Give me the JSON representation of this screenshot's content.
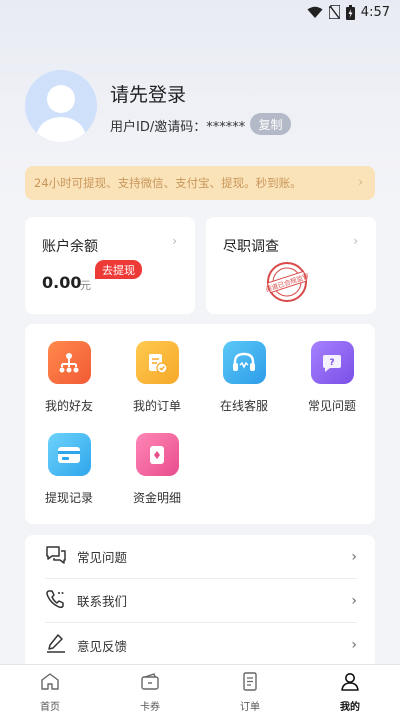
{
  "status_bar": {
    "time": "4:57"
  },
  "profile": {
    "login_prompt": "请先登录",
    "user_id_label": "用户ID/邀请码：",
    "user_id_value": "******",
    "copy_label": "复制"
  },
  "notice": {
    "text": "24小时可提现、支持微信、支付宝、提现。秒到账。"
  },
  "balance_card": {
    "title": "账户余额",
    "withdraw_label": "去提现",
    "amount": "0.00",
    "unit": "元"
  },
  "duty_card": {
    "title": "尽职调查",
    "stamp_text": "渠道已合规监管"
  },
  "grid": {
    "items": [
      {
        "label": "我的好友",
        "icon": "friends-icon",
        "color": "#f66a3c"
      },
      {
        "label": "我的订单",
        "icon": "orders-icon",
        "color": "#f7b73a"
      },
      {
        "label": "在线客服",
        "icon": "headset-icon",
        "color": "#3aaef0"
      },
      {
        "label": "常见问题",
        "icon": "question-icon",
        "color": "#8a62f2"
      },
      {
        "label": "提现记录",
        "icon": "card-icon",
        "color": "#33b4ef"
      },
      {
        "label": "资金明细",
        "icon": "funds-icon",
        "color": "#ee5e9c"
      }
    ]
  },
  "list": {
    "items": [
      {
        "label": "常见问题",
        "icon": "chat-icon"
      },
      {
        "label": "联系我们",
        "icon": "phone-icon"
      },
      {
        "label": "意见反馈",
        "icon": "edit-icon"
      }
    ]
  },
  "tabs": [
    {
      "label": "首页",
      "icon": "home-icon",
      "active": false
    },
    {
      "label": "卡券",
      "icon": "coupon-icon",
      "active": false
    },
    {
      "label": "订单",
      "icon": "order-icon",
      "active": false
    },
    {
      "label": "我的",
      "icon": "person-icon",
      "active": true
    }
  ]
}
